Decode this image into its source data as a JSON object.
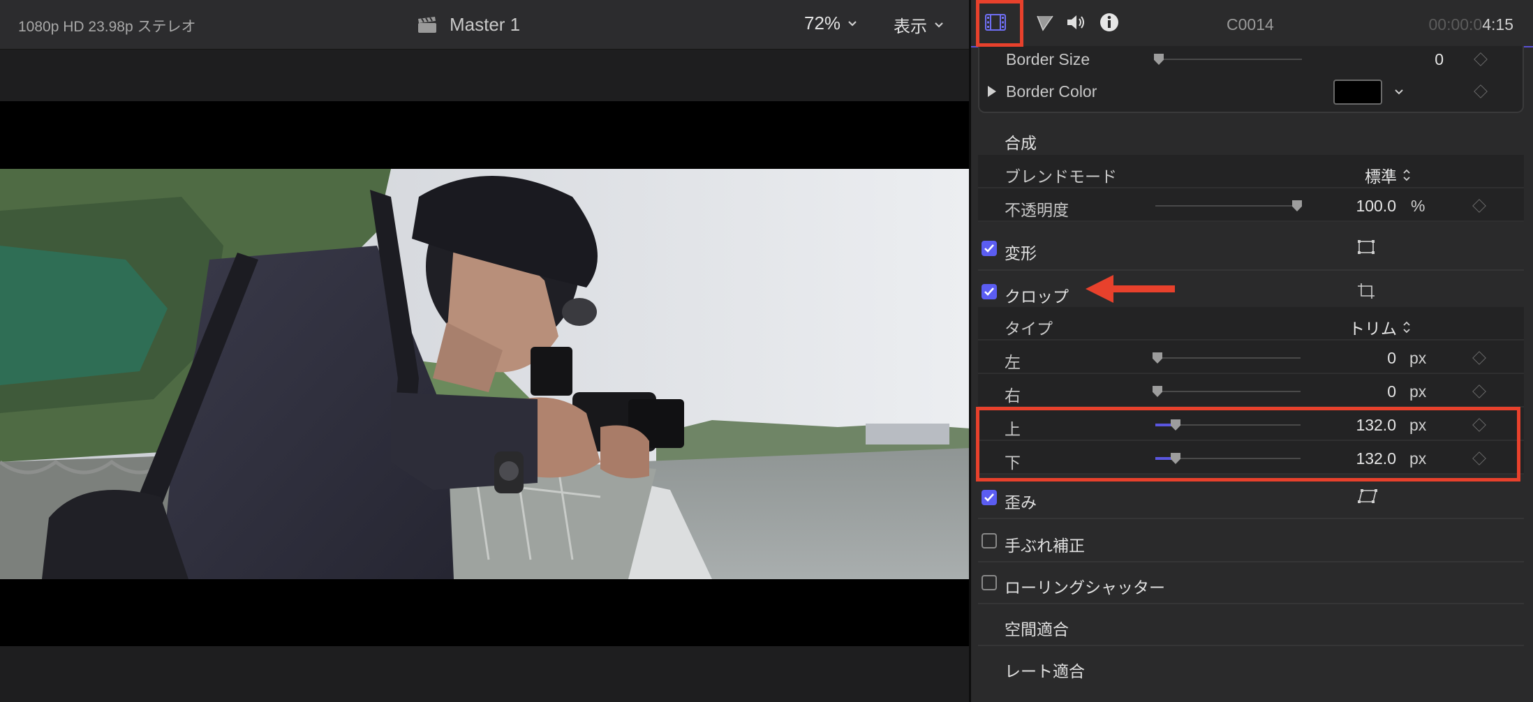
{
  "viewer": {
    "format": "1080p HD 23.98p ステレオ",
    "project_title": "Master 1",
    "zoom": "72%",
    "view_menu": "表示"
  },
  "inspector": {
    "clip_name": "C0014",
    "timecode_dim": "00:00:0",
    "timecode_bright": "4:15",
    "border_size": {
      "label": "Border Size",
      "value": "0"
    },
    "border_color": {
      "label": "Border Color"
    },
    "compositing": {
      "title": "合成",
      "blend_mode": {
        "label": "ブレンドモード",
        "value": "標準"
      },
      "opacity": {
        "label": "不透明度",
        "value": "100.0",
        "unit": "%",
        "level": 1.0
      }
    },
    "transform": {
      "title": "変形",
      "enabled": true
    },
    "crop": {
      "title": "クロップ",
      "enabled": true,
      "type": {
        "label": "タイプ",
        "value": "トリム"
      },
      "left": {
        "label": "左",
        "value": "0",
        "unit": "px"
      },
      "right": {
        "label": "右",
        "value": "0",
        "unit": "px"
      },
      "top": {
        "label": "上",
        "value": "132.0",
        "unit": "px"
      },
      "bottom": {
        "label": "下",
        "value": "132.0",
        "unit": "px"
      }
    },
    "distort": {
      "title": "歪み",
      "enabled": true
    },
    "stabilization": {
      "title": "手ぶれ補正",
      "enabled": false
    },
    "rolling_shutter": {
      "title": "ローリングシャッター",
      "enabled": false
    },
    "spatial_conform": {
      "title": "空間適合"
    },
    "rate_conform": {
      "title": "レート適合"
    }
  },
  "colors": {
    "accent": "#5b5df2",
    "highlight": "#e8412c"
  }
}
